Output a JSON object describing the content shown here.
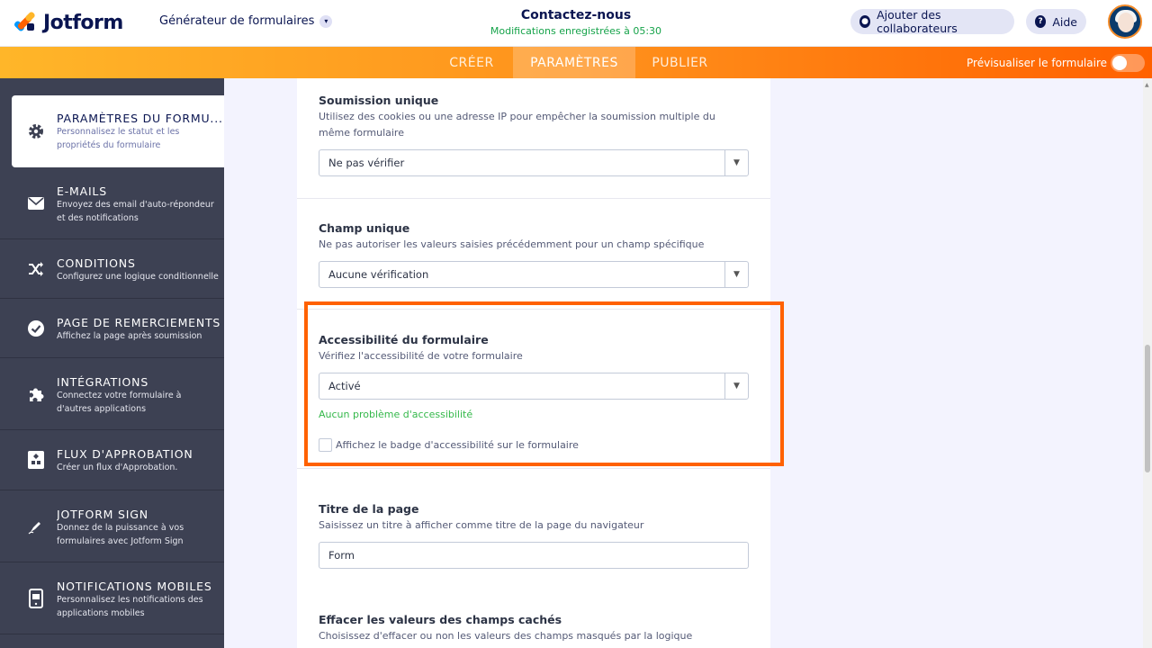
{
  "header": {
    "logo_text": "Jotform",
    "builder_title": "Générateur de formulaires",
    "form_title": "Contactez-nous",
    "saved_status": "Modifications enregistrées à 05:30",
    "add_collaborators": "Ajouter des collaborateurs",
    "help": "Aide"
  },
  "nav": {
    "tabs": [
      "CRÉER",
      "PARAMÈTRES",
      "PUBLIER"
    ],
    "active_tab": "PARAMÈTRES",
    "preview_label": "Prévisualiser le formulaire",
    "preview_enabled": false
  },
  "sidebar": {
    "items": [
      {
        "title": "PARAMÈTRES DU FORMU...",
        "desc": "Personnalisez le statut et les propriétés du formulaire",
        "icon": "gear-icon",
        "active": true
      },
      {
        "title": "E-MAILS",
        "desc": "Envoyez des email d'auto-répondeur et des notifications",
        "icon": "envelope-icon"
      },
      {
        "title": "CONDITIONS",
        "desc": "Configurez une logique conditionnelle",
        "icon": "shuffle-icon"
      },
      {
        "title": "PAGE DE REMERCIEMENTS",
        "desc": "Affichez la page après soumission",
        "icon": "check-circle-icon"
      },
      {
        "title": "INTÉGRATIONS",
        "desc": "Connectez votre formulaire à d'autres applications",
        "icon": "puzzle-icon"
      },
      {
        "title": "FLUX D'APPROBATION",
        "desc": "Créer un flux d'Approbation.",
        "icon": "flow-icon"
      },
      {
        "title": "JOTFORM SIGN",
        "desc": "Donnez de la puissance à vos formulaires avec Jotform Sign",
        "icon": "pen-icon"
      },
      {
        "title": "NOTIFICATIONS MOBILES",
        "desc": "Personnalisez les notifications des applications mobiles",
        "icon": "mobile-icon"
      }
    ]
  },
  "settings": {
    "unique_submission": {
      "title": "Soumission unique",
      "desc": "Utilisez des cookies ou une adresse IP pour empêcher la soumission multiple du même formulaire",
      "value": "Ne pas vérifier"
    },
    "unique_field": {
      "title": "Champ unique",
      "desc": "Ne pas autoriser les valeurs saisies précédemment pour un champ spécifique",
      "value": "Aucune vérification"
    },
    "accessibility": {
      "title": "Accessibilité du formulaire",
      "desc": "Vérifiez l'accessibilité de votre formulaire",
      "value": "Activé",
      "status": "Aucun problème d'accessibilité",
      "badge_label": "Affichez le badge d'accessibilité sur le formulaire",
      "badge_checked": false
    },
    "page_title": {
      "title": "Titre de la page",
      "desc": "Saisissez un titre à afficher comme titre de la page du navigateur",
      "value": "Form"
    },
    "clear_hidden": {
      "title": "Effacer les valeurs des champs cachés",
      "desc": "Choisissez d'effacer ou non les valeurs des champs masqués par la logique conditionnelle"
    }
  },
  "colors": {
    "accent": "#ff6100",
    "brand_navy": "#0a1551",
    "sidebar_bg": "#3d4153",
    "success": "#34b84a"
  }
}
